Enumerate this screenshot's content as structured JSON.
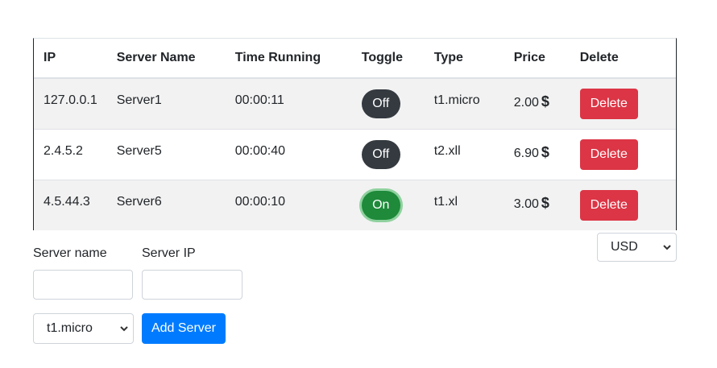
{
  "table": {
    "headers": [
      "IP",
      "Server Name",
      "Time Running",
      "Toggle",
      "Type",
      "Price",
      "Delete"
    ],
    "rows": [
      {
        "ip": "127.0.0.1",
        "name": "Server1",
        "time": "00:00:11",
        "toggle": "Off",
        "type": "t1.micro",
        "price": "2.00",
        "currency_symbol": "$",
        "delete": "Delete"
      },
      {
        "ip": "2.4.5.2",
        "name": "Server5",
        "time": "00:00:40",
        "toggle": "Off",
        "type": "t2.xll",
        "price": "6.90",
        "currency_symbol": "$",
        "delete": "Delete"
      },
      {
        "ip": "4.5.44.3",
        "name": "Server6",
        "time": "00:00:10",
        "toggle": "On",
        "type": "t1.xl",
        "price": "3.00",
        "currency_symbol": "$",
        "delete": "Delete"
      }
    ]
  },
  "currency_select": {
    "selected": "USD",
    "icon": "chevron-down-icon"
  },
  "form": {
    "server_name_label": "Server name",
    "server_ip_label": "Server IP",
    "server_name_value": "",
    "server_ip_value": "",
    "type_selected": "t1.micro",
    "add_button": "Add Server"
  },
  "colors": {
    "toggle_off": "#343a40",
    "toggle_on": "#1e8a3a",
    "delete": "#dc3545",
    "primary": "#007bff"
  }
}
